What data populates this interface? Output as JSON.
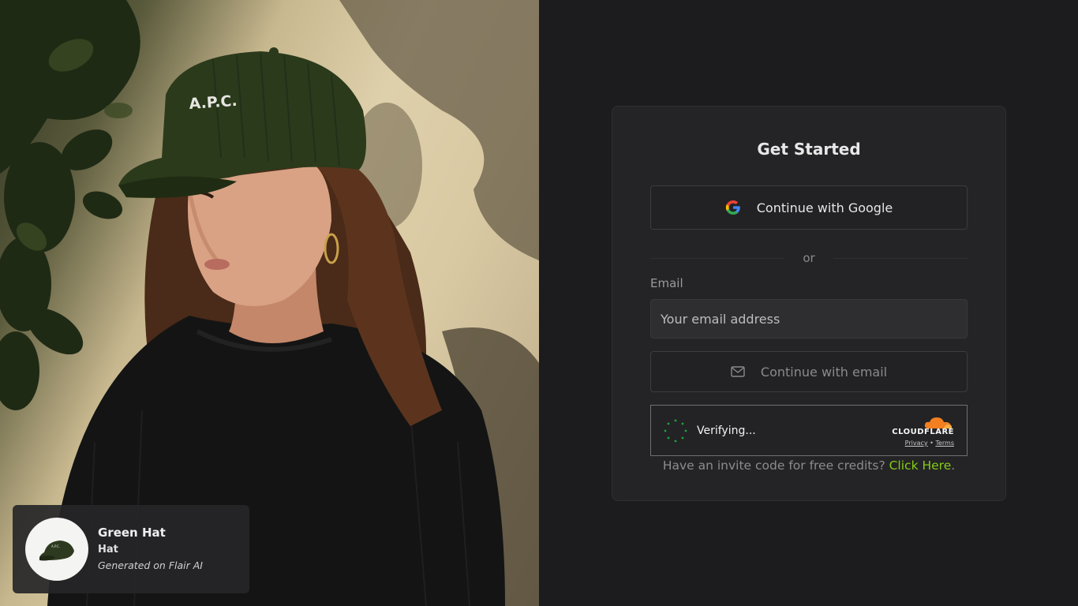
{
  "product": {
    "name": "Green Hat",
    "type": "Hat",
    "note": "Generated on Flair AI",
    "thumb_icon": "green-cap-thumbnail"
  },
  "auth": {
    "title": "Get Started",
    "google_label": "Continue with Google",
    "divider": "or",
    "email_label": "Email",
    "email_placeholder": "Your email address",
    "email_value": "",
    "email_button": "Continue with email",
    "captcha": {
      "status": "Verifying...",
      "brand": "CLOUDFLARE",
      "privacy": "Privacy",
      "separator": "•",
      "terms": "Terms"
    },
    "invite_text": "Have an invite code for free credits?",
    "invite_link": "Click Here",
    "invite_end": "."
  },
  "colors": {
    "page_bg": "#1c1c1e",
    "card_bg": "#242426",
    "accent": "#84cc16",
    "cloudflare_orange": "#f38020"
  },
  "icons": [
    "google-icon",
    "mail-icon",
    "spinner-icon",
    "cloudflare-cloud-icon"
  ]
}
